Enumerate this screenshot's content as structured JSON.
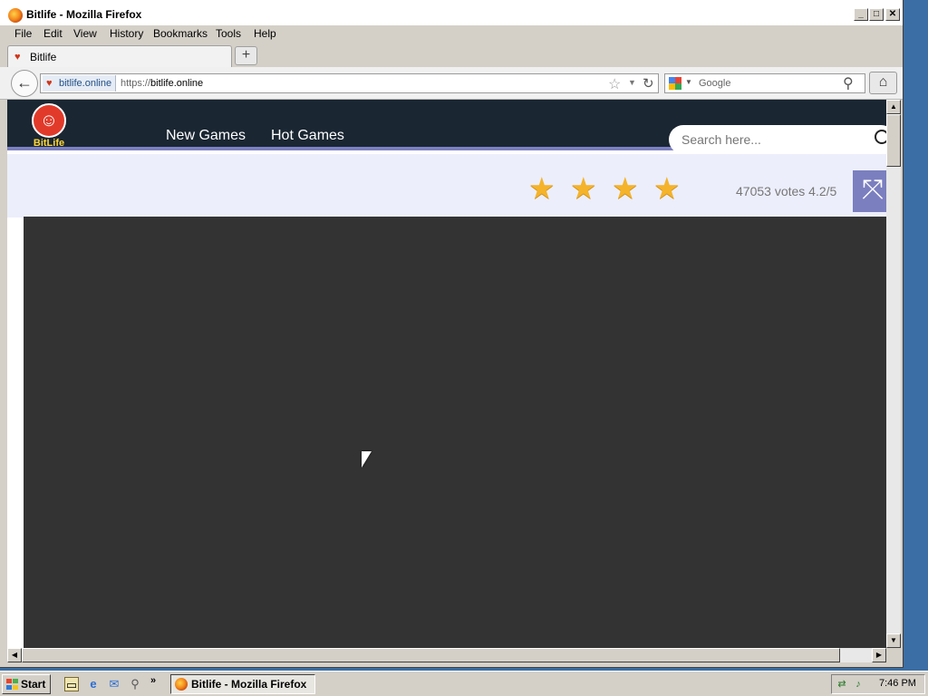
{
  "window": {
    "title": "Bitlife - Mozilla Firefox",
    "minimize": "_",
    "maximize": "□",
    "close": "✕"
  },
  "menu": [
    "File",
    "Edit",
    "View",
    "History",
    "Bookmarks",
    "Tools",
    "Help"
  ],
  "tab": {
    "label": "Bitlife",
    "new_tab": "+"
  },
  "nav": {
    "back": "←",
    "identity": "bitlife.online",
    "url_scheme": "https://",
    "url_host": "bitlife.online",
    "search_engine": "Google",
    "home": "⌂"
  },
  "site": {
    "logo_text": "BitLife",
    "nav_items": [
      "New Games",
      "Hot Games"
    ],
    "search_placeholder": "Search here...",
    "rating_stars": 4,
    "votes_text": "47053 votes 4.2/5",
    "fullscreen": "⤧"
  },
  "taskbar": {
    "start": "Start",
    "task_label": "Bitlife - Mozilla Firefox",
    "more": "»",
    "clock": "7:46 PM"
  },
  "colors": {
    "header_bg": "#1a2632",
    "accent": "#7b7fbf",
    "rating_bg": "#eceefb",
    "game_bg": "#333333",
    "star": "#f4b32a"
  },
  "icons": {
    "quick_launch": [
      "show-desktop-icon",
      "internet-explorer-icon",
      "outlook-icon",
      "search-icon"
    ],
    "tray": [
      "network-icon",
      "volume-icon"
    ]
  }
}
